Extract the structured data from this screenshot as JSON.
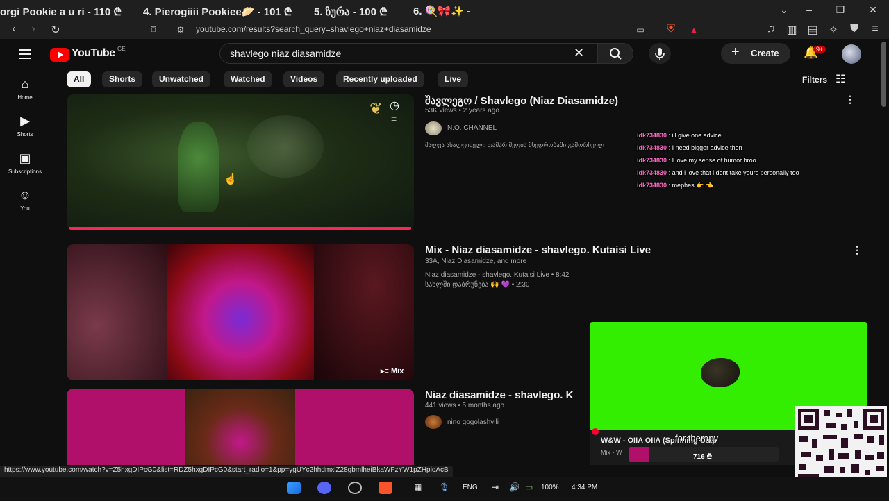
{
  "browser": {
    "tabs": [
      {
        "label": "orgi Pookie a u ri - 110 ₾"
      },
      {
        "label": "4. Pierogiiii Pookiee🥟 - 101 ₾"
      },
      {
        "label": "5. ზურა - 100 ₾"
      },
      {
        "label": "6. 🍭🎀✨ -"
      }
    ],
    "url": "youtube.com/results?search_query=shavlego+niaz+diasamidze",
    "status_url": "https://www.youtube.com/watch?v=Z5hxgDIPcG0&list=RDZ5hxgDIPcG0&start_radio=1&pp=ygUYc2hhdmxlZ28gbmlheiBkaWFzYW1pZHploAcB"
  },
  "header": {
    "logo_text": "YouTube",
    "region": "GE",
    "search_value": "shavlego niaz diasamidze",
    "create_label": "Create",
    "notif_count": "9+"
  },
  "sidebar": {
    "items": [
      {
        "label": "Home",
        "icon": "home-icon"
      },
      {
        "label": "Shorts",
        "icon": "shorts-icon"
      },
      {
        "label": "Subscriptions",
        "icon": "subscriptions-icon"
      },
      {
        "label": "You",
        "icon": "you-icon"
      }
    ]
  },
  "chips": [
    "All",
    "Shorts",
    "Unwatched",
    "Watched",
    "Videos",
    "Recently uploaded",
    "Live"
  ],
  "filters_label": "Filters",
  "results": [
    {
      "title": "შავლეგო / Shavlego (Niaz Diasamidze)",
      "meta": "53K views • 2 years ago",
      "channel": "N.O. CHANNEL",
      "description": "შალვა ახალციხელი თამარ მეფის მხედრობაში გამორჩეულ"
    },
    {
      "title": "Mix - Niaz diasamidze - shavlego.  Kutaisi  Live",
      "meta": "33A, Niaz Diasamidze, and more",
      "line1": "Niaz diasamidze - shavlego. Kutaisi Live • 8:42",
      "line2": "სახლში დაბრუნება 🙌 💜 • 2:30",
      "badge": "Mix"
    },
    {
      "title": "Niaz diasamidze - shavlego. K",
      "meta": "441 views • 5 months ago",
      "channel": "nino gogolashvili"
    }
  ],
  "chat": [
    {
      "user": "idk734830",
      "text": ": ill give one advice"
    },
    {
      "user": "idk734830",
      "text": ": I need bigger advice then"
    },
    {
      "user": "idk734830",
      "text": ": I love my sense of humor broo"
    },
    {
      "user": "idk734830",
      "text": ": and i love that i dont take yours personally too"
    },
    {
      "user": "idk734830",
      "text": ": mephes 👉 👈"
    }
  ],
  "media": {
    "title": "W&W - OIIA OIIA (Spinning Cat)",
    "subtitle": "Mix - W",
    "overlay_text": "for therapy",
    "price": "716 ₾"
  },
  "taskbar": {
    "lang": "ENG",
    "battery": "100%",
    "time": "4:34 PM"
  },
  "colors": {
    "accent_red": "#ff0000",
    "greenscreen": "#33ee00",
    "chat_user": "#ff69c4"
  }
}
